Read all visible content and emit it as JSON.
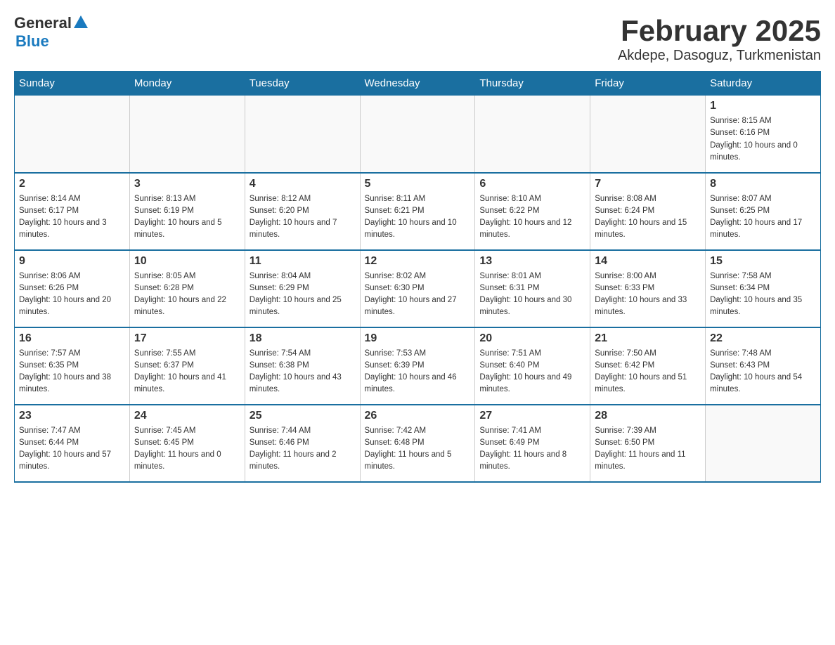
{
  "logo": {
    "general": "General",
    "blue": "Blue"
  },
  "title": "February 2025",
  "subtitle": "Akdepe, Dasoguz, Turkmenistan",
  "days_of_week": [
    "Sunday",
    "Monday",
    "Tuesday",
    "Wednesday",
    "Thursday",
    "Friday",
    "Saturday"
  ],
  "weeks": [
    [
      {
        "day": "",
        "info": ""
      },
      {
        "day": "",
        "info": ""
      },
      {
        "day": "",
        "info": ""
      },
      {
        "day": "",
        "info": ""
      },
      {
        "day": "",
        "info": ""
      },
      {
        "day": "",
        "info": ""
      },
      {
        "day": "1",
        "info": "Sunrise: 8:15 AM\nSunset: 6:16 PM\nDaylight: 10 hours and 0 minutes."
      }
    ],
    [
      {
        "day": "2",
        "info": "Sunrise: 8:14 AM\nSunset: 6:17 PM\nDaylight: 10 hours and 3 minutes."
      },
      {
        "day": "3",
        "info": "Sunrise: 8:13 AM\nSunset: 6:19 PM\nDaylight: 10 hours and 5 minutes."
      },
      {
        "day": "4",
        "info": "Sunrise: 8:12 AM\nSunset: 6:20 PM\nDaylight: 10 hours and 7 minutes."
      },
      {
        "day": "5",
        "info": "Sunrise: 8:11 AM\nSunset: 6:21 PM\nDaylight: 10 hours and 10 minutes."
      },
      {
        "day": "6",
        "info": "Sunrise: 8:10 AM\nSunset: 6:22 PM\nDaylight: 10 hours and 12 minutes."
      },
      {
        "day": "7",
        "info": "Sunrise: 8:08 AM\nSunset: 6:24 PM\nDaylight: 10 hours and 15 minutes."
      },
      {
        "day": "8",
        "info": "Sunrise: 8:07 AM\nSunset: 6:25 PM\nDaylight: 10 hours and 17 minutes."
      }
    ],
    [
      {
        "day": "9",
        "info": "Sunrise: 8:06 AM\nSunset: 6:26 PM\nDaylight: 10 hours and 20 minutes."
      },
      {
        "day": "10",
        "info": "Sunrise: 8:05 AM\nSunset: 6:28 PM\nDaylight: 10 hours and 22 minutes."
      },
      {
        "day": "11",
        "info": "Sunrise: 8:04 AM\nSunset: 6:29 PM\nDaylight: 10 hours and 25 minutes."
      },
      {
        "day": "12",
        "info": "Sunrise: 8:02 AM\nSunset: 6:30 PM\nDaylight: 10 hours and 27 minutes."
      },
      {
        "day": "13",
        "info": "Sunrise: 8:01 AM\nSunset: 6:31 PM\nDaylight: 10 hours and 30 minutes."
      },
      {
        "day": "14",
        "info": "Sunrise: 8:00 AM\nSunset: 6:33 PM\nDaylight: 10 hours and 33 minutes."
      },
      {
        "day": "15",
        "info": "Sunrise: 7:58 AM\nSunset: 6:34 PM\nDaylight: 10 hours and 35 minutes."
      }
    ],
    [
      {
        "day": "16",
        "info": "Sunrise: 7:57 AM\nSunset: 6:35 PM\nDaylight: 10 hours and 38 minutes."
      },
      {
        "day": "17",
        "info": "Sunrise: 7:55 AM\nSunset: 6:37 PM\nDaylight: 10 hours and 41 minutes."
      },
      {
        "day": "18",
        "info": "Sunrise: 7:54 AM\nSunset: 6:38 PM\nDaylight: 10 hours and 43 minutes."
      },
      {
        "day": "19",
        "info": "Sunrise: 7:53 AM\nSunset: 6:39 PM\nDaylight: 10 hours and 46 minutes."
      },
      {
        "day": "20",
        "info": "Sunrise: 7:51 AM\nSunset: 6:40 PM\nDaylight: 10 hours and 49 minutes."
      },
      {
        "day": "21",
        "info": "Sunrise: 7:50 AM\nSunset: 6:42 PM\nDaylight: 10 hours and 51 minutes."
      },
      {
        "day": "22",
        "info": "Sunrise: 7:48 AM\nSunset: 6:43 PM\nDaylight: 10 hours and 54 minutes."
      }
    ],
    [
      {
        "day": "23",
        "info": "Sunrise: 7:47 AM\nSunset: 6:44 PM\nDaylight: 10 hours and 57 minutes."
      },
      {
        "day": "24",
        "info": "Sunrise: 7:45 AM\nSunset: 6:45 PM\nDaylight: 11 hours and 0 minutes."
      },
      {
        "day": "25",
        "info": "Sunrise: 7:44 AM\nSunset: 6:46 PM\nDaylight: 11 hours and 2 minutes."
      },
      {
        "day": "26",
        "info": "Sunrise: 7:42 AM\nSunset: 6:48 PM\nDaylight: 11 hours and 5 minutes."
      },
      {
        "day": "27",
        "info": "Sunrise: 7:41 AM\nSunset: 6:49 PM\nDaylight: 11 hours and 8 minutes."
      },
      {
        "day": "28",
        "info": "Sunrise: 7:39 AM\nSunset: 6:50 PM\nDaylight: 11 hours and 11 minutes."
      },
      {
        "day": "",
        "info": ""
      }
    ]
  ]
}
